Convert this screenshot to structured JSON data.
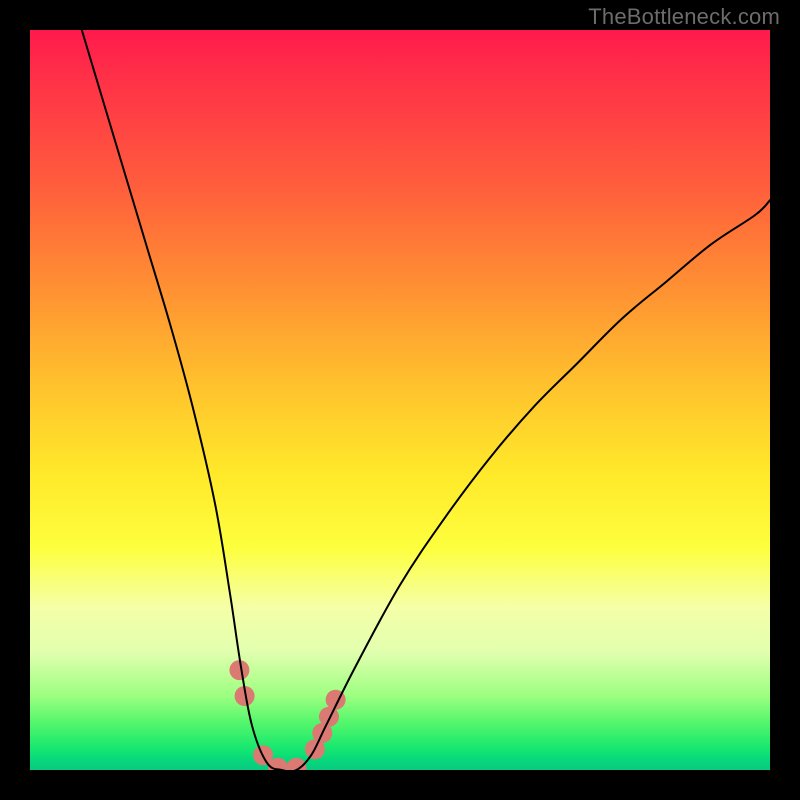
{
  "watermark": "TheBottleneck.com",
  "chart_data": {
    "type": "line",
    "title": "",
    "xlabel": "",
    "ylabel": "",
    "xlim": [
      0,
      100
    ],
    "ylim": [
      0,
      100
    ],
    "series": [
      {
        "name": "curve",
        "color": "#000000",
        "width": 2.0,
        "x": [
          7,
          10,
          13,
          16,
          19,
          22,
          25,
          27,
          28.5,
          30,
          32,
          34,
          36,
          38,
          40,
          44,
          50,
          56,
          62,
          68,
          74,
          80,
          86,
          92,
          98,
          100
        ],
        "y": [
          100,
          90,
          80,
          70,
          60,
          49,
          36,
          24,
          14,
          6,
          1,
          0,
          0,
          2,
          6,
          14,
          25,
          34,
          42,
          49,
          55,
          61,
          66,
          71,
          75,
          77
        ]
      }
    ],
    "markers": {
      "name": "highlight",
      "color": "#da7a73",
      "radius": 10,
      "points": [
        {
          "x": 28.3,
          "y": 13.5
        },
        {
          "x": 29.0,
          "y": 10.0
        },
        {
          "x": 31.5,
          "y": 2.0
        },
        {
          "x": 33.5,
          "y": 0.3
        },
        {
          "x": 36.0,
          "y": 0.3
        },
        {
          "x": 38.5,
          "y": 2.8
        },
        {
          "x": 39.5,
          "y": 5.0
        },
        {
          "x": 40.4,
          "y": 7.2
        },
        {
          "x": 41.3,
          "y": 9.5
        }
      ]
    }
  }
}
